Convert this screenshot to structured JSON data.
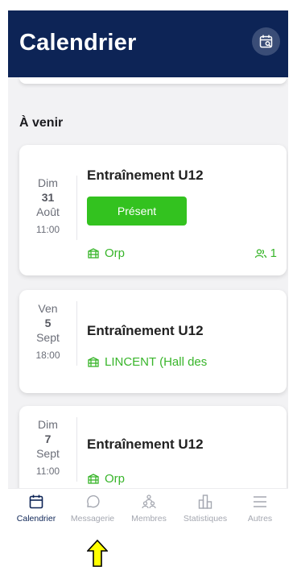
{
  "header": {
    "title": "Calendrier",
    "calendar_icon": "calendar-search-icon"
  },
  "section": {
    "title": "À venir"
  },
  "events": [
    {
      "weekday": "Dim",
      "day": "31",
      "month": "Août",
      "time": "11:00",
      "title": "Entraînement U12",
      "status_button": "Présent",
      "location": "Orp",
      "attendees": "1"
    },
    {
      "weekday": "Ven",
      "day": "5",
      "month": "Sept",
      "time": "18:00",
      "title": "Entraînement U12",
      "location": "LINCENT (Hall des"
    },
    {
      "weekday": "Dim",
      "day": "7",
      "month": "Sept",
      "time": "11:00",
      "title": "Entraînement U12",
      "location": "Orp"
    }
  ],
  "tabs": [
    {
      "label": "Calendrier",
      "icon": "calendar-icon",
      "active": true
    },
    {
      "label": "Messagerie",
      "icon": "chat-icon",
      "active": false
    },
    {
      "label": "Membres",
      "icon": "members-icon",
      "active": false
    },
    {
      "label": "Statistiques",
      "icon": "stats-icon",
      "active": false
    },
    {
      "label": "Autres",
      "icon": "menu-icon",
      "active": false
    }
  ],
  "colors": {
    "header": "#0d2456",
    "present": "#33c21f",
    "location": "#38b52a",
    "pointer": "#ffff00"
  }
}
